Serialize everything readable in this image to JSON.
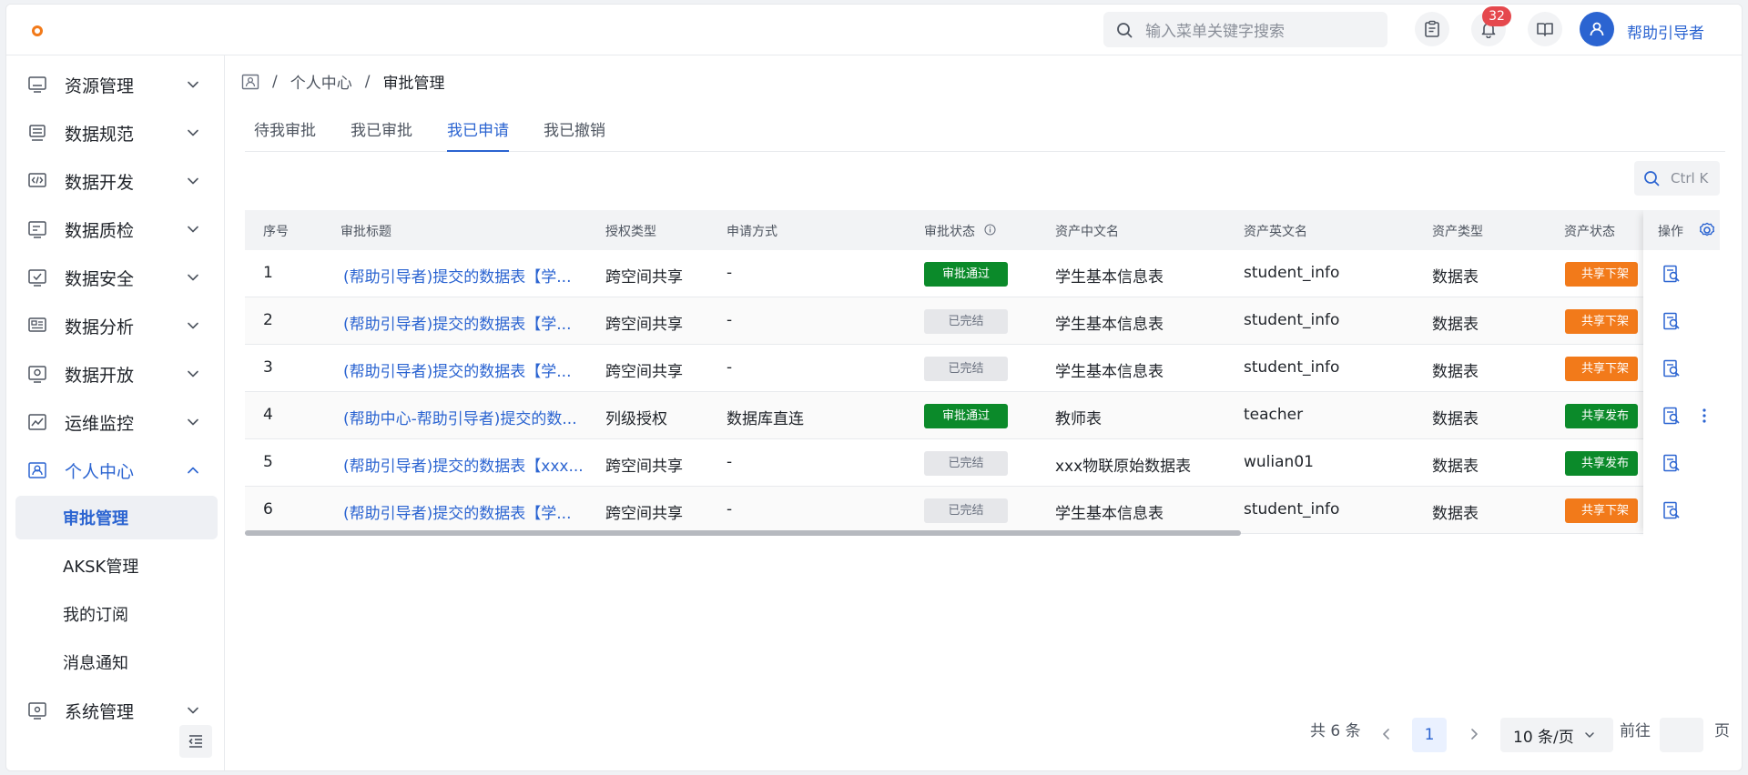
{
  "header": {
    "search_placeholder": "输入菜单关键字搜索",
    "notification_count": "32",
    "user_name": "帮助引导者"
  },
  "sidebar": {
    "items": [
      {
        "label": "资源管理",
        "icon": "monitor-icon"
      },
      {
        "label": "数据规范",
        "icon": "server-icon"
      },
      {
        "label": "数据开发",
        "icon": "code-icon"
      },
      {
        "label": "数据质检",
        "icon": "doc-screen-icon"
      },
      {
        "label": "数据安全",
        "icon": "check-screen-icon"
      },
      {
        "label": "数据分析",
        "icon": "analytics-icon"
      },
      {
        "label": "数据开放",
        "icon": "share-screen-icon"
      },
      {
        "label": "运维监控",
        "icon": "line-chart-icon"
      },
      {
        "label": "个人中心",
        "icon": "person-card-icon"
      }
    ],
    "sub_items": [
      "审批管理",
      "AKSK管理",
      "我的订阅",
      "消息通知"
    ],
    "last_item": {
      "label": "系统管理",
      "icon": "settings-screen-icon"
    }
  },
  "breadcrumb": {
    "level1": "个人中心",
    "sep": "/",
    "current": "审批管理"
  },
  "tabs": [
    "待我审批",
    "我已审批",
    "我已申请",
    "我已撤销"
  ],
  "active_tab": 2,
  "table_search_hint": "Ctrl K",
  "table": {
    "headers": [
      "序号",
      "审批标题",
      "授权类型",
      "申请方式",
      "审批状态",
      "资产中文名",
      "资产英文名",
      "资产类型",
      "资产状态",
      "操作"
    ],
    "rows": [
      {
        "no": "1",
        "title": "(帮助引导者)提交的数据表【学...",
        "auth": "跨空间共享",
        "method": "-",
        "status": "审批通过",
        "cn": "学生基本信息表",
        "en": "student_info",
        "type": "数据表",
        "asset_status": "共享下架"
      },
      {
        "no": "2",
        "title": "(帮助引导者)提交的数据表【学...",
        "auth": "跨空间共享",
        "method": "-",
        "status": "已完结",
        "cn": "学生基本信息表",
        "en": "student_info",
        "type": "数据表",
        "asset_status": "共享下架"
      },
      {
        "no": "3",
        "title": "(帮助引导者)提交的数据表【学...",
        "auth": "跨空间共享",
        "method": "-",
        "status": "已完结",
        "cn": "学生基本信息表",
        "en": "student_info",
        "type": "数据表",
        "asset_status": "共享下架"
      },
      {
        "no": "4",
        "title": "(帮助中心-帮助引导者)提交的数...",
        "auth": "列级授权",
        "method": "数据库直连",
        "status": "审批通过",
        "cn": "教师表",
        "en": "teacher",
        "type": "数据表",
        "asset_status": "共享发布"
      },
      {
        "no": "5",
        "title": "(帮助引导者)提交的数据表【xxx...",
        "auth": "跨空间共享",
        "method": "-",
        "status": "已完结",
        "cn": "xxx物联原始数据表",
        "en": "wulian01",
        "type": "数据表",
        "asset_status": "共享发布"
      },
      {
        "no": "6",
        "title": "(帮助引导者)提交的数据表【学...",
        "auth": "跨空间共享",
        "method": "-",
        "status": "已完结",
        "cn": "学生基本信息表",
        "en": "student_info",
        "type": "数据表",
        "asset_status": "共享下架"
      }
    ]
  },
  "pagination": {
    "total": "共 6 条",
    "current": "1",
    "page_size": "10 条/页",
    "goto_prefix": "前往",
    "goto_suffix": "页"
  },
  "colors": {
    "accent": "#2b64d1",
    "status_pass": "#0b8a2a",
    "status_done": "#e6e7ea",
    "asset_down": "#f27a1a",
    "asset_up": "#0b8a2a",
    "badge": "#e5484d"
  }
}
